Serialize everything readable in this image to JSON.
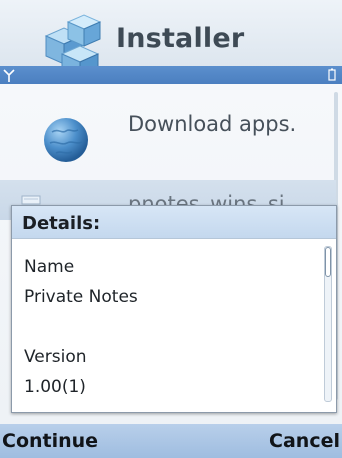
{
  "app": {
    "title": "Installer"
  },
  "list": {
    "items": [
      {
        "label": "Download apps."
      },
      {
        "label": "pnotes_wins_si"
      }
    ]
  },
  "dialog": {
    "title": "Details:",
    "fields": [
      {
        "label": "Name",
        "value": "Private Notes"
      },
      {
        "label": "Version",
        "value": "1.00(1)"
      }
    ]
  },
  "softkeys": {
    "left": "Continue",
    "right": "Cancel"
  },
  "icons": {
    "app": "installer-blocks-icon",
    "signal": "signal-icon",
    "battery": "battery-icon",
    "list_item_1": "globe-icon",
    "list_item_2": "sis-package-icon"
  },
  "colors": {
    "status_strip": "#5b8fcd",
    "dialog_header": "#c4d8ee",
    "softkey_bar": "#a9c5e5"
  }
}
